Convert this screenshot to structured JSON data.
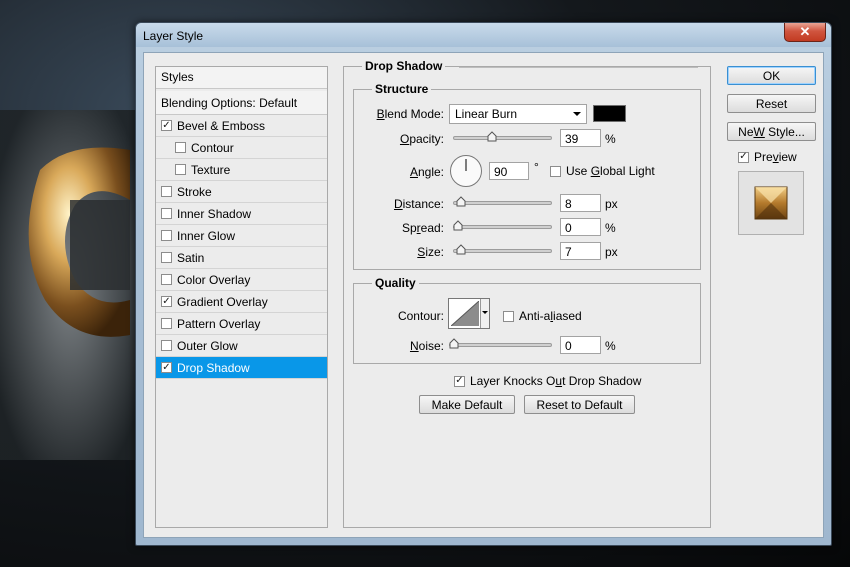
{
  "window": {
    "title": "Layer Style",
    "close_glyph": "✕"
  },
  "styles_list": {
    "header": "Styles",
    "blending_options": "Blending Options: Default",
    "items": [
      {
        "label": "Bevel & Emboss",
        "checked": true,
        "sub": false,
        "selected": false
      },
      {
        "label": "Contour",
        "checked": false,
        "sub": true,
        "selected": false
      },
      {
        "label": "Texture",
        "checked": false,
        "sub": true,
        "selected": false
      },
      {
        "label": "Stroke",
        "checked": false,
        "sub": false,
        "selected": false
      },
      {
        "label": "Inner Shadow",
        "checked": false,
        "sub": false,
        "selected": false
      },
      {
        "label": "Inner Glow",
        "checked": false,
        "sub": false,
        "selected": false
      },
      {
        "label": "Satin",
        "checked": false,
        "sub": false,
        "selected": false
      },
      {
        "label": "Color Overlay",
        "checked": false,
        "sub": false,
        "selected": false
      },
      {
        "label": "Gradient Overlay",
        "checked": true,
        "sub": false,
        "selected": false
      },
      {
        "label": "Pattern Overlay",
        "checked": false,
        "sub": false,
        "selected": false
      },
      {
        "label": "Outer Glow",
        "checked": false,
        "sub": false,
        "selected": false
      },
      {
        "label": "Drop Shadow",
        "checked": true,
        "sub": false,
        "selected": true
      }
    ]
  },
  "drop_shadow": {
    "title": "Drop Shadow",
    "structure": {
      "title": "Structure",
      "blend_mode_label": "lend Mode:",
      "blend_mode_key": "B",
      "blend_mode_value": "Linear Burn",
      "shadow_color": "#000000",
      "opacity_label_key": "O",
      "opacity_label_rest": "pacity:",
      "opacity_value": "39",
      "opacity_unit": "%",
      "angle_label_key": "A",
      "angle_label_rest": "ngle:",
      "angle_value": "90",
      "angle_unit": "°",
      "global_light_pre": "Use ",
      "global_light_key": "G",
      "global_light_post": "lobal Light",
      "global_light_checked": false,
      "distance_label_key": "D",
      "distance_label_rest": "istance:",
      "distance_value": "8",
      "distance_unit": "px",
      "spread_label_pre": "Sp",
      "spread_label_key": "r",
      "spread_label_post": "ead:",
      "spread_value": "0",
      "spread_unit": "%",
      "size_label_key": "S",
      "size_label_rest": "ize:",
      "size_value": "7",
      "size_unit": "px"
    },
    "quality": {
      "title": "Quality",
      "contour_label": "Contour:",
      "anti_aliased_pre": "Anti-a",
      "anti_aliased_key": "l",
      "anti_aliased_post": "iased",
      "anti_aliased_checked": false,
      "noise_label_key": "N",
      "noise_label_rest": "oise:",
      "noise_value": "0",
      "noise_unit": "%"
    },
    "knockout_label_pre": "Layer Knocks O",
    "knockout_label_key": "u",
    "knockout_label_post": "t Drop Shadow",
    "knockout_checked": true,
    "make_default": "Make Default",
    "reset_to_default": "Reset to Default"
  },
  "buttons": {
    "ok": "OK",
    "reset": "Reset",
    "new_style_key": "W",
    "new_style_pre": "Ne",
    "new_style_post": " Style...",
    "preview_pre": "Pre",
    "preview_key": "v",
    "preview_post": "iew",
    "preview_checked": true
  },
  "colors": {
    "selection": "#0997e8",
    "panel": "#ececec"
  }
}
